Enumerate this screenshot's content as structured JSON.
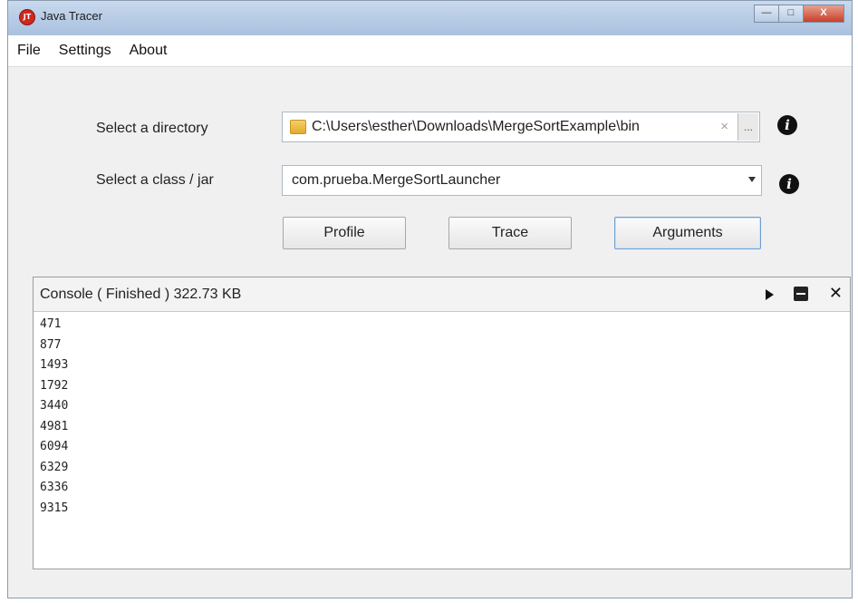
{
  "window": {
    "title": "Java Tracer",
    "app_icon_text": "JT",
    "controls": [
      "—",
      "□",
      "X"
    ]
  },
  "menu": [
    "File",
    "Settings",
    "About"
  ],
  "form": {
    "directory_label": "Select a directory",
    "directory_value": "C:\\Users\\esther\\Downloads\\MergeSortExample\\bin",
    "directory_clear": "×",
    "directory_browse": "...",
    "class_label": "Select a class / jar",
    "class_value": "com.prueba.MergeSortLauncher",
    "info_glyph": "i"
  },
  "buttons": {
    "profile": "Profile",
    "trace": "Trace",
    "arguments": "Arguments"
  },
  "console": {
    "title": "Console ( Finished ) 322.73 KB",
    "close_glyph": "✕",
    "lines": [
      "471",
      "877",
      "1493",
      "1792",
      "3440",
      "4981",
      "6094",
      "6329",
      "6336",
      "9315"
    ]
  },
  "colors": {
    "titlebar": "#b9cde6",
    "window_bg": "#f0f0f0",
    "close_button": "#c8402a",
    "app_icon": "#d0281d",
    "focus_border": "#6f9fd4"
  }
}
